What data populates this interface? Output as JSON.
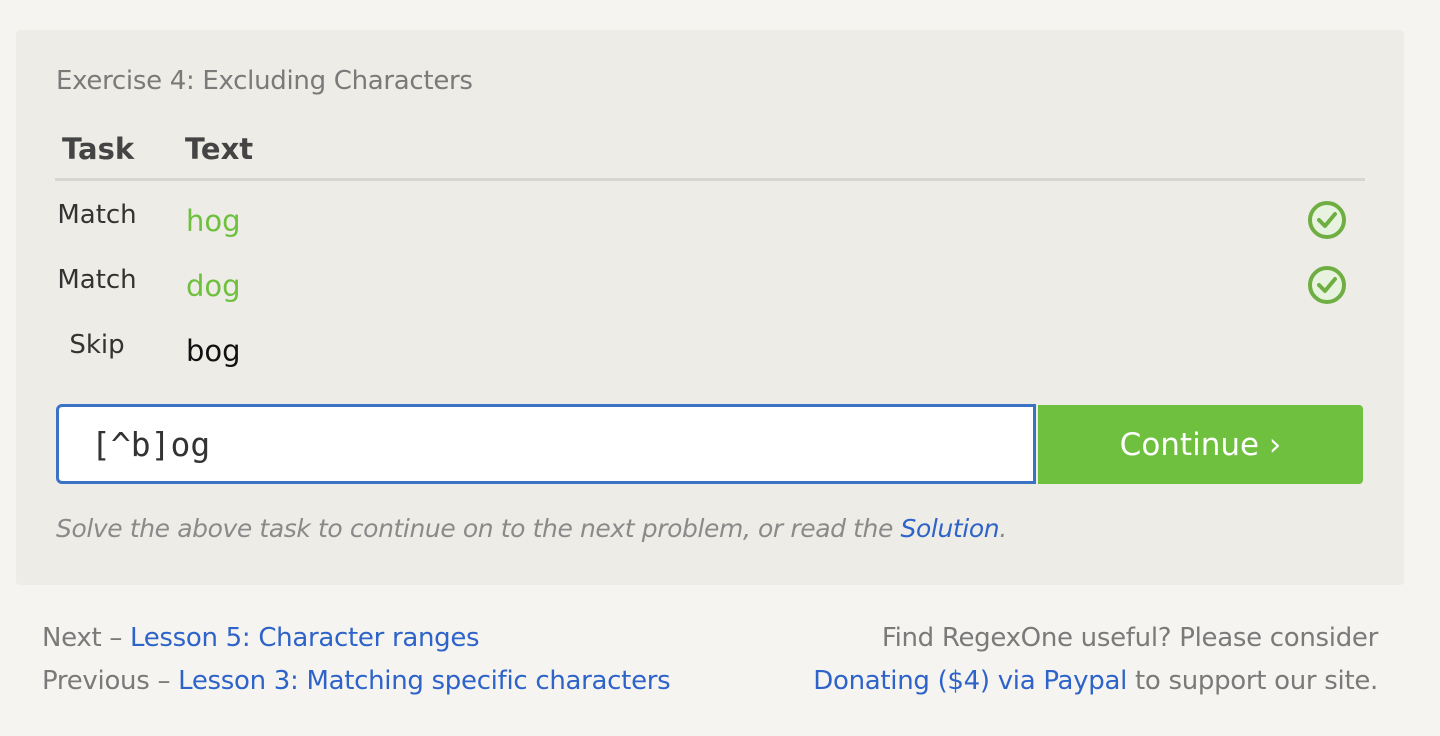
{
  "exercise": {
    "title": "Exercise 4: Excluding Characters",
    "headers": {
      "task": "Task",
      "text": "Text"
    },
    "rows": [
      {
        "task": "Match",
        "text": "hog",
        "status": "matched",
        "icon": "check-circle-icon"
      },
      {
        "task": "Match",
        "text": "dog",
        "status": "matched",
        "icon": "check-circle-icon"
      },
      {
        "task": "Skip",
        "text": "bog",
        "status": "skipped"
      }
    ],
    "input_value": "[^b]og",
    "continue_label": "Continue ›",
    "hint_prefix": "Solve the above task to continue on to the next problem, or read the ",
    "hint_link": "Solution",
    "hint_suffix": "."
  },
  "footer": {
    "next_prefix": "Next – ",
    "next_link": "Lesson 5: Character ranges",
    "previous_prefix": "Previous – ",
    "previous_link": "Lesson 3: Matching specific characters",
    "donate_prefix": "Find RegexOne useful? Please consider",
    "donate_link": "Donating ($4) via Paypal",
    "donate_suffix": " to support our site."
  },
  "colors": {
    "match_green": "#6fc03f",
    "link_blue": "#2e63c9",
    "input_border": "#3b73c4"
  }
}
